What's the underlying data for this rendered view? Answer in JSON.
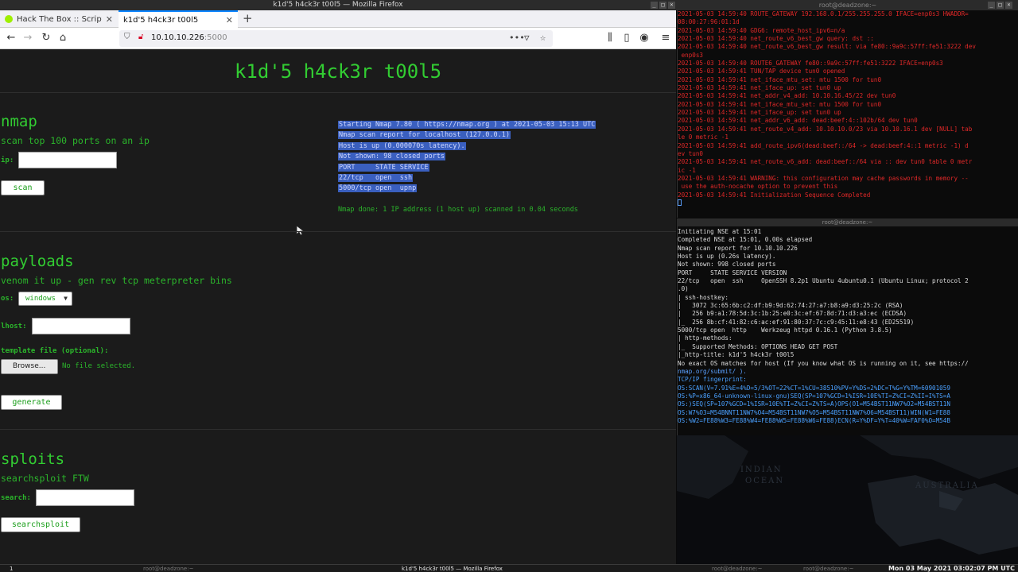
{
  "os": {
    "firefox_window_title": "k1d'5 h4ck3r t00l5 — Mozilla Firefox",
    "terminal_window_title": "root@deadzone:~",
    "terminal2_window_title": "root@deadzone:~"
  },
  "browser": {
    "tabs": [
      {
        "label": "Hack The Box :: ScriptKid",
        "active": false
      },
      {
        "label": "k1d'5 h4ck3r t00l5",
        "active": true
      }
    ],
    "url_host": "10.10.10.226",
    "url_port": ":5000"
  },
  "page": {
    "title": "k1d'5 h4ck3r t00l5",
    "nmap": {
      "heading": "nmap",
      "subtitle": "scan top 100 ports on an ip",
      "ip_label": "ip:",
      "ip_value": "",
      "scan_button": "scan",
      "output_lines": [
        "Starting Nmap 7.80 ( https://nmap.org ) at 2021-05-03 15:13 UTC",
        "Nmap scan report for localhost (127.0.0.1)",
        "Host is up (0.000070s latency).",
        "Not shown: 98 closed ports",
        "PORT     STATE SERVICE",
        "22/tcp   open  ssh",
        "5000/tcp open  upnp"
      ],
      "done_line": "Nmap done: 1 IP address (1 host up) scanned in 0.04 seconds"
    },
    "payloads": {
      "heading": "payloads",
      "subtitle": "venom it up - gen rev tcp meterpreter bins",
      "os_label": "os:",
      "os_selected": "windows",
      "lhost_label": "lhost:",
      "lhost_value": "",
      "template_label": "template file (optional):",
      "browse_button": "Browse...",
      "no_file_text": "No file selected.",
      "generate_button": "generate"
    },
    "sploits": {
      "heading": "sploits",
      "subtitle": "searchsploit FTW",
      "search_label": "search:",
      "search_value": "",
      "search_button": "searchsploit"
    }
  },
  "terminal1": {
    "lines": [
      "2021-05-03 14:59:40 ROUTE_GATEWAY 192.168.0.1/255.255.255.0 IFACE=enp0s3 HWADDR=",
      "08:00:27:96:01:1d",
      "2021-05-03 14:59:40 GDG6: remote_host_ipv6=n/a",
      "2021-05-03 14:59:40 net_route_v6_best_gw query: dst ::",
      "2021-05-03 14:59:40 net_route_v6_best_gw result: via fe80::9a9c:57ff:fe51:3222 dev",
      " enp0s3",
      "2021-05-03 14:59:40 ROUTE6_GATEWAY fe80::9a9c:57ff:fe51:3222 IFACE=enp0s3",
      "2021-05-03 14:59:41 TUN/TAP device tun0 opened",
      "2021-05-03 14:59:41 net_iface_mtu_set: mtu 1500 for tun0",
      "2021-05-03 14:59:41 net_iface_up: set tun0 up",
      "2021-05-03 14:59:41 net_addr_v4_add: 10.10.16.45/22 dev tun0",
      "2021-05-03 14:59:41 net_iface_mtu_set: mtu 1500 for tun0",
      "2021-05-03 14:59:41 net_iface_up: set tun0 up",
      "2021-05-03 14:59:41 net_addr_v6_add: dead:beef:4::102b/64 dev tun0",
      "2021-05-03 14:59:41 net_route_v4_add: 10.10.10.0/23 via 10.10.16.1 dev [NULL] tab",
      "le 0 metric -1",
      "2021-05-03 14:59:41 add_route_ipv6(dead:beef::/64 -> dead:beef:4::1 metric -1) d",
      "ev tun0",
      "2021-05-03 14:59:41 net_route_v6_add: dead:beef::/64 via :: dev tun0 table 0 metr",
      "ic -1",
      "2021-05-03 14:59:41 WARNING: this configuration may cache passwords in memory --",
      " use the auth-nocache option to prevent this",
      "2021-05-03 14:59:41 Initialization Sequence Completed"
    ]
  },
  "terminal2": {
    "lines": [
      "Initiating NSE at 15:01",
      "Completed NSE at 15:01, 0.00s elapsed",
      "Nmap scan report for 10.10.10.226",
      "Host is up (0.26s latency).",
      "Not shown: 998 closed ports",
      "PORT     STATE SERVICE VERSION",
      "22/tcp   open  ssh     OpenSSH 8.2p1 Ubuntu 4ubuntu0.1 (Ubuntu Linux; protocol 2",
      ".0)",
      "| ssh-hostkey:",
      "|   3072 3c:65:6b:c2:df:b9:9d:62:74:27:a7:b8:a9:d3:25:2c (RSA)",
      "|   256 b9:a1:78:5d:3c:1b:25:e0:3c:ef:67:8d:71:d3:a3:ec (ECDSA)",
      "|_  256 8b:cf:41:82:c6:ac:ef:91:80:37:7c:c9:45:11:e8:43 (ED25519)",
      "5000/tcp open  http    Werkzeug httpd 0.16.1 (Python 3.8.5)",
      "| http-methods:",
      "|_  Supported Methods: OPTIONS HEAD GET POST",
      "|_http-title: k1d'5 h4ck3r t00l5",
      "No exact OS matches for host (If you know what OS is running on it, see https://",
      "nmap.org/submit/ ).",
      "TCP/IP fingerprint:",
      "OS:SCAN(V=7.91%E=4%D=5/3%OT=22%CT=1%CU=38510%PV=Y%DS=2%DC=T%G=Y%TM=60901059",
      "OS:%P=x86_64-unknown-linux-gnu)SEQ(SP=107%GCD=1%ISR=10E%TI=Z%CI=Z%II=I%TS=A",
      "OS:)SEQ(SP=107%GCD=1%ISR=10E%TI=Z%CI=Z%TS=A)OPS(O1=M54BST11NW7%O2=M54BST11N",
      "OS:W7%O3=M54BNNT11NW7%O4=M54BST11NW7%O5=M54BST11NW7%O6=M54BST11)WIN(W1=FE88",
      "OS:%W2=FE88%W3=FE88%W4=FE88%W5=FE88%W6=FE88)ECN(R=Y%DF=Y%T=40%W=FAF0%O=M54B"
    ],
    "url_line_index": 16,
    "hi_line_indexes": [
      18,
      19,
      20,
      21,
      22,
      23
    ]
  },
  "map": {
    "labels": [
      "INDIAN",
      "OCEAN",
      "AUSTRALIA"
    ]
  },
  "taskbar": {
    "workspace": "1",
    "items": [
      "root@deadzone:~",
      "k1d'5 h4ck3r t00l5 — Mozilla Firefox",
      "root@deadzone:~",
      "root@deadzone:~"
    ],
    "clock": "Mon 03 May 2021 03:02:07 PM UTC"
  },
  "colors": {
    "accent_green": "#32cd32",
    "terminal_red": "#e02828",
    "selection_blue": "#3a5fbf",
    "firefox_tab_accent": "#0a84ff"
  }
}
